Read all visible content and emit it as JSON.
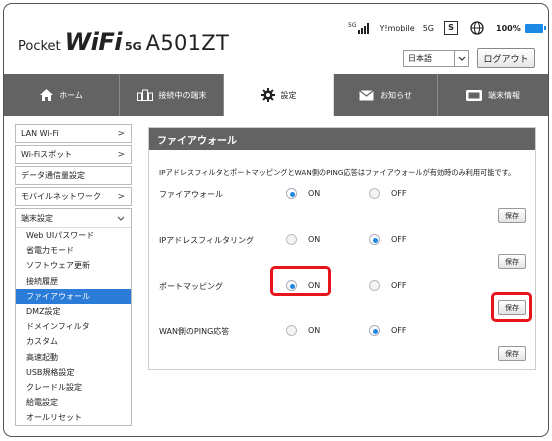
{
  "brand": {
    "pocket": "Pocket",
    "wifi": "WiFi",
    "fiveg": "5G",
    "model": "A501ZT"
  },
  "status": {
    "signal_tag": "5G",
    "carrier": "Y!mobile",
    "network": "5G",
    "sim": "S",
    "battery": "100%",
    "accent": "#1e88e5"
  },
  "language": {
    "selected": "日本語"
  },
  "logout_label": "ログアウト",
  "nav": [
    {
      "label": "ホーム",
      "icon": "home-icon"
    },
    {
      "label": "接続中の端末",
      "icon": "devices-icon"
    },
    {
      "label": "設定",
      "icon": "gear-icon"
    },
    {
      "label": "お知らせ",
      "icon": "mail-icon"
    },
    {
      "label": "端末情報",
      "icon": "device-info-icon"
    }
  ],
  "sidebar": {
    "top_items": [
      "LAN Wi-Fi",
      "Wi-Fiスポット",
      "データ通信量設定",
      "モバイルネットワーク"
    ],
    "group_label": "端末設定",
    "sub_items": [
      "Web UIパスワード",
      "省電力モード",
      "ソフトウェア更新",
      "接続履歴",
      "ファイアウォール",
      "DMZ設定",
      "ドメインフィルタ",
      "カスタム",
      "高速起動",
      "USB規格設定",
      "クレードル設定",
      "給電設定",
      "オールリセット"
    ]
  },
  "main": {
    "title": "ファイアウォール",
    "notice": "IPアドレスフィルタとポートマッピングとWAN側のPING応答はファイアウォールが有効時のみ利用可能です。",
    "on_label": "ON",
    "off_label": "OFF",
    "save_label": "保存",
    "rows": [
      {
        "label": "ファイアウォール",
        "value": "ON"
      },
      {
        "label": "IPアドレスフィルタリング",
        "value": "OFF"
      },
      {
        "label": "ポートマッピング",
        "value": "ON"
      },
      {
        "label": "WAN側のPING応答",
        "value": "OFF"
      }
    ]
  },
  "highlight_color": "#e8141c"
}
